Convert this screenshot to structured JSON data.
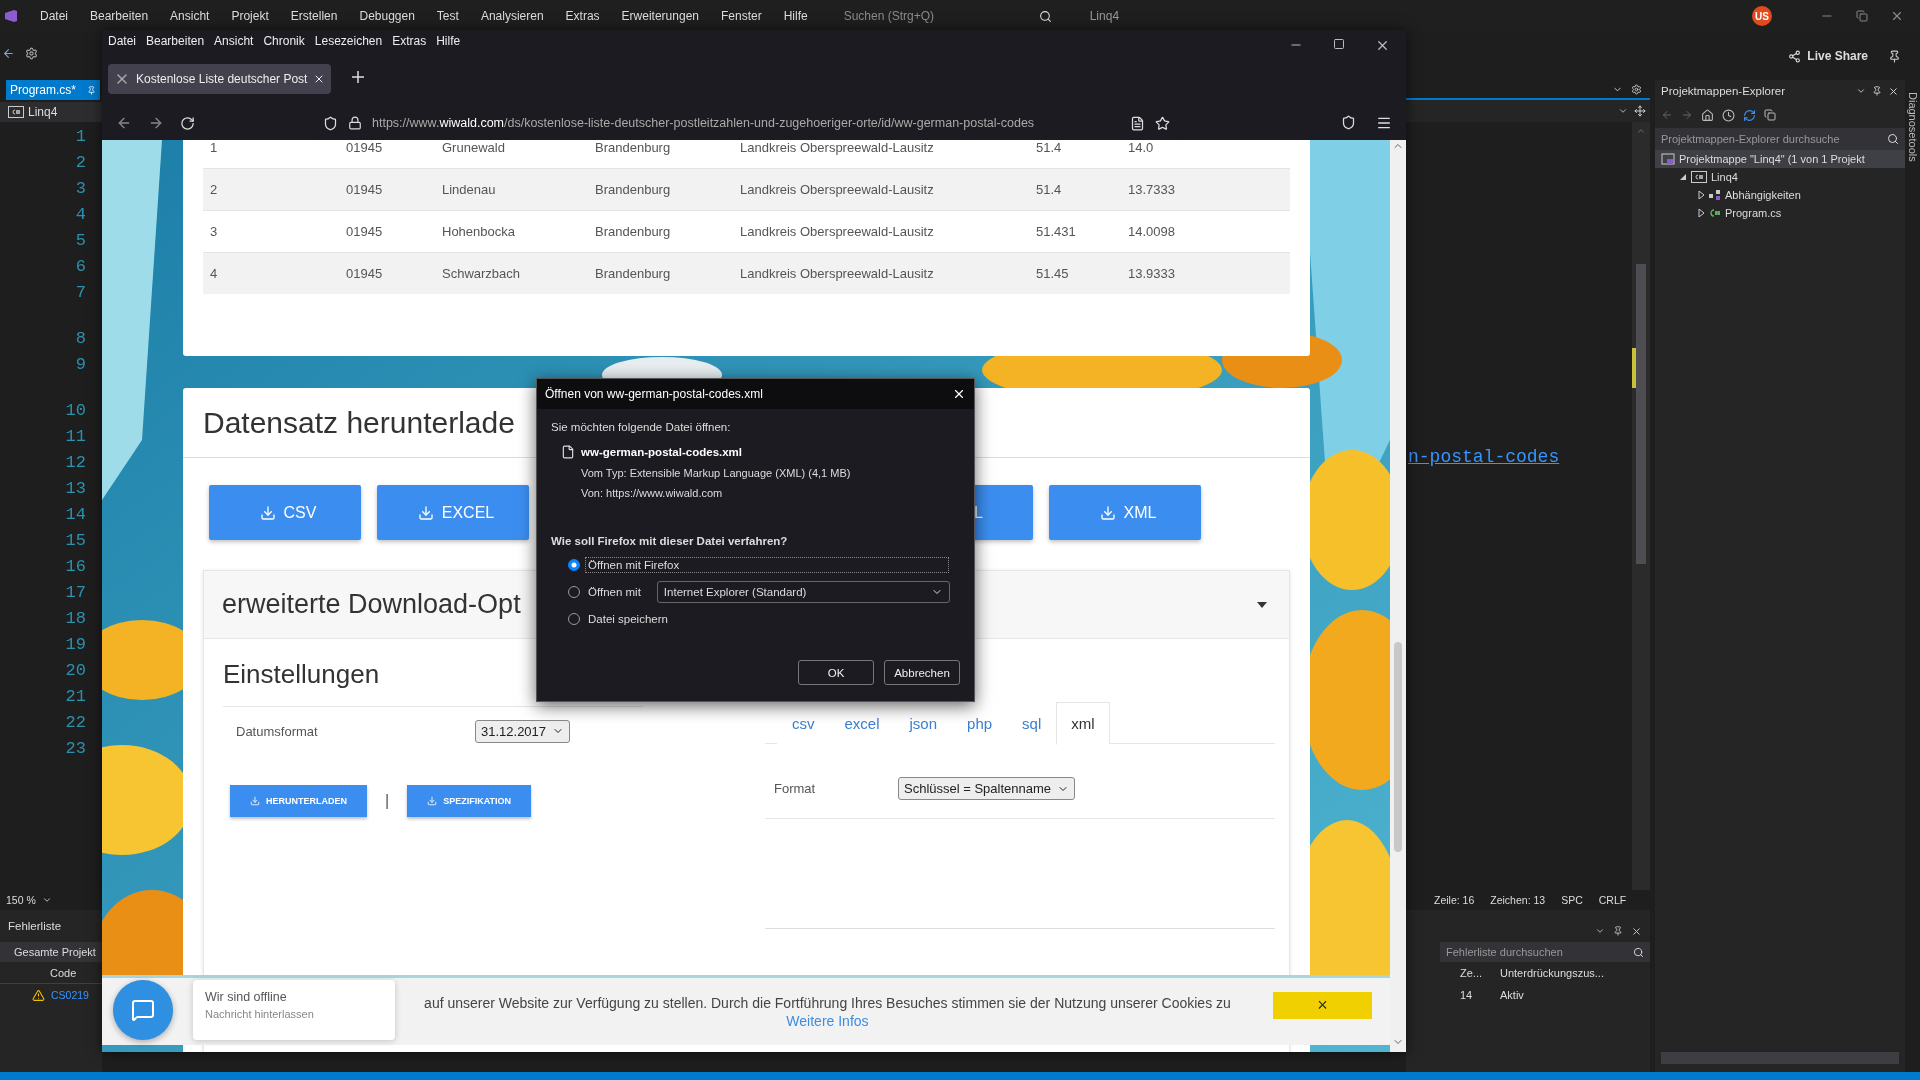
{
  "vs": {
    "menu": [
      "Datei",
      "Bearbeiten",
      "Ansicht",
      "Projekt",
      "Erstellen",
      "Debuggen",
      "Test",
      "Analysieren",
      "Extras",
      "Erweiterungen",
      "Fenster",
      "Hilfe"
    ],
    "search": {
      "placeholder": "Suchen (Strg+Q)"
    },
    "solution_name": "Linq4",
    "account": "US",
    "live_share": "Live Share",
    "editor_tab": {
      "label": "Program.cs*"
    },
    "project_dropdown": "Linq4",
    "line_numbers": [
      "1",
      "2",
      "3",
      "4",
      "5",
      "6",
      "7",
      "8",
      "9",
      "10",
      "11",
      "12",
      "13",
      "14",
      "15",
      "16",
      "17",
      "18",
      "19",
      "20",
      "21",
      "22",
      "23"
    ],
    "link_text": "n-postal-codes",
    "zoom": "150 %",
    "status": [
      "Zeile: 16",
      "Zeichen: 13",
      "SPC",
      "CRLF"
    ],
    "error_list": {
      "title": "Fehlerliste",
      "scope": "Gesamte Projekt",
      "search": {
        "placeholder": "Fehlerliste durchsuchen"
      },
      "columns": [
        "Code",
        "Ze...",
        "Unterdrückungszus..."
      ],
      "rows": [
        {
          "code": "CS0219",
          "line": "14",
          "state": "Aktiv"
        }
      ]
    },
    "solution_explorer": {
      "title": "Projektmappen-Explorer",
      "search": {
        "placeholder": "Projektmappen-Explorer durchsuche"
      },
      "tree": [
        {
          "label": "Projektmappe \"Linq4\" (1 von 1 Projekt",
          "kind": "solution",
          "selected": true,
          "children": [
            {
              "label": "Linq4",
              "kind": "project",
              "expanded": true,
              "selected": false,
              "children": [
                {
                  "label": "Abhängigkeiten",
                  "kind": "dependencies",
                  "expanded": false,
                  "selected": false
                },
                {
                  "label": "Program.cs",
                  "kind": "csfile",
                  "expanded": false,
                  "selected": false
                }
              ]
            }
          ]
        }
      ]
    },
    "side_tab": "Diagnosetools"
  },
  "firefox": {
    "menu": [
      "Datei",
      "Bearbeiten",
      "Ansicht",
      "Chronik",
      "Lesezeichen",
      "Extras",
      "Hilfe"
    ],
    "tab": {
      "title": "Kostenlose Liste deutscher Post"
    },
    "url": "https://www.**wiwald.com**/ds/kostenlose-liste-deutscher-postleitzahlen-und-zugehoeriger-orte/id/ww-german-postal-codes",
    "table": {
      "rows": [
        [
          "1",
          "01945",
          "Grunewald",
          "Brandenburg",
          "Landkreis Oberspreewald-Lausitz",
          "51.4",
          "14.0"
        ],
        [
          "2",
          "01945",
          "Lindenau",
          "Brandenburg",
          "Landkreis Oberspreewald-Lausitz",
          "51.4",
          "13.7333"
        ],
        [
          "3",
          "01945",
          "Hohenbocka",
          "Brandenburg",
          "Landkreis Oberspreewald-Lausitz",
          "51.431",
          "14.0098"
        ],
        [
          "4",
          "01945",
          "Schwarzbach",
          "Brandenburg",
          "Landkreis Oberspreewald-Lausitz",
          "51.45",
          "13.9333"
        ]
      ]
    },
    "download": {
      "title": "Datensatz herunterlade",
      "buttons": [
        "CSV",
        "EXCEL",
        "L",
        "XML"
      ]
    },
    "options": {
      "title": "erweiterte Download-Opt",
      "settings_title": "Einstellungen",
      "date_label": "Datumsformat",
      "date_value": "31.12.2017",
      "actions": [
        "HERUNTERLADEN",
        "SPEZIFIKATION"
      ],
      "separator": "|",
      "format_tabs": [
        {
          "label": "csv",
          "selected": false
        },
        {
          "label": "excel",
          "selected": false
        },
        {
          "label": "json",
          "selected": false
        },
        {
          "label": "php",
          "selected": false
        },
        {
          "label": "sql",
          "selected": false
        },
        {
          "label": "xml",
          "selected": true
        }
      ],
      "format_label": "Format",
      "format_value": "Schlüssel = Spaltenname"
    },
    "cookie": {
      "text": "auf unserer Website zur Verfügung zu stellen. Durch die Fortführung Ihres Besuches stimmen sie der Nutzung unserer Cookies zu",
      "link": "Weitere Infos",
      "close": "×"
    },
    "chat": {
      "title": "Wir sind offline",
      "subtitle": "Nachricht hinterlassen"
    },
    "dialog": {
      "title": "Öffnen von ww-german-postal-codes.xml",
      "intro": "Sie möchten folgende Datei öffnen:",
      "file": "ww-german-postal-codes.xml",
      "type_label": "Vom Typ:",
      "type_value": "Extensible Markup Language (XML) (4,1 MB)",
      "from_label": "Von:",
      "from_value": "https://www.wiwald.com",
      "question": "Wie soll Firefox mit dieser Datei verfahren?",
      "options": [
        {
          "label": "Öffnen mit Firefox",
          "selected": true
        },
        {
          "label": "Öffnen mit",
          "selected": false,
          "app": "Internet Explorer (Standard)"
        },
        {
          "label": "Datei speichern",
          "selected": false
        }
      ],
      "buttons": [
        "OK",
        "Abbrechen"
      ]
    }
  }
}
